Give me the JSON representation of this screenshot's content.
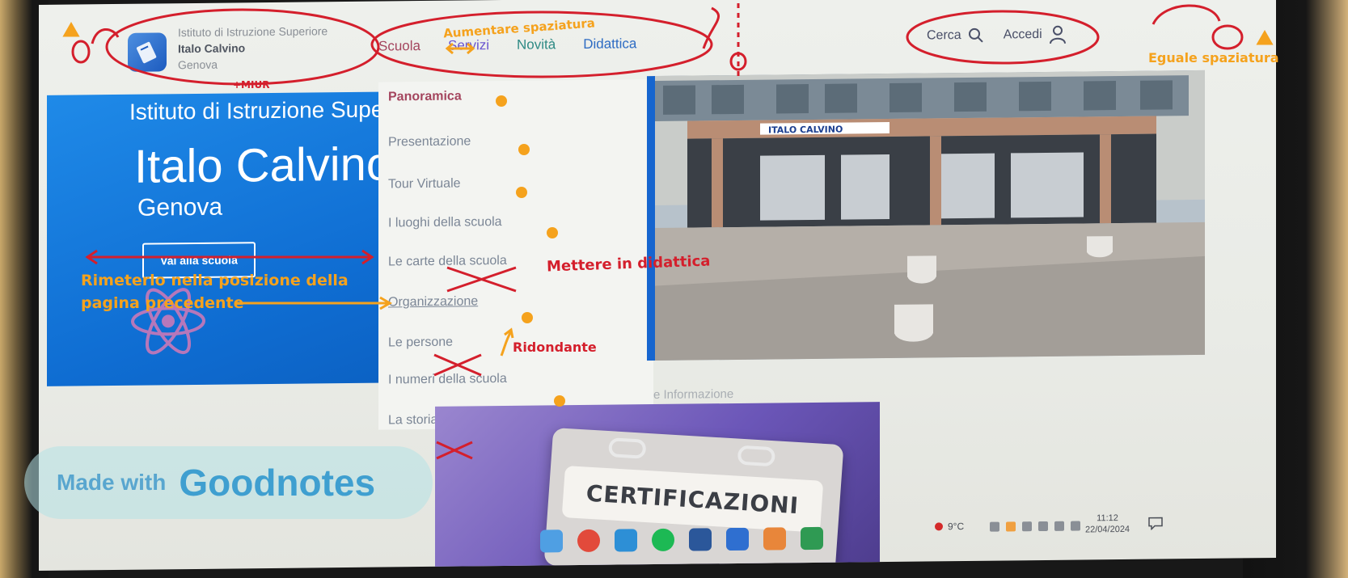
{
  "header": {
    "brand_line1": "Istituto di Istruzione Superiore",
    "brand_line2": "Italo Calvino",
    "brand_line3": "Genova",
    "nav": [
      "Scuola",
      "Servizi",
      "Novità",
      "Didattica"
    ],
    "search_label": "Cerca",
    "login_label": "Accedi"
  },
  "hero": {
    "title_small": "Istituto di Istruzione Supe",
    "title": "Italo Calvino",
    "subtitle": "Genova",
    "button_label": "Vai alla scuola"
  },
  "dropdown": {
    "items": [
      "Panoramica",
      "Presentazione",
      "Tour Virtuale",
      "I luoghi della scuola",
      "Le carte della scuola",
      "Organizzazione",
      "Le persone",
      "I numeri della scuola",
      "La storia"
    ]
  },
  "photo": {
    "sign_text": "ITALO CALVINO"
  },
  "lower": {
    "info_label": "e Informazione",
    "card_text": "CERTIFICAZIONI"
  },
  "taskbar": {
    "temperature": "9°C",
    "time": "11:12",
    "date": "22/04/2024"
  },
  "watermark": {
    "small": "Made with",
    "big": "Goodnotes"
  },
  "annotations": {
    "spacing_increase": "Aumentare spaziatura",
    "miur": "+MIUR",
    "equal_spacing": "Eguale spaziatura",
    "restore_line1": "Rimeterlo nella posizione della",
    "restore_line2": "pagina precedente",
    "move_to_didattica": "Mettere in didattica",
    "redundant": "Ridondante"
  },
  "colors": {
    "accent_red": "#d41f2c",
    "accent_orange": "#f5a21d",
    "hero_blue": "#1478de",
    "nav_scuola": "#a4455e",
    "nav_servizi": "#6a55d0",
    "nav_novita": "#2e8a84",
    "nav_didattica": "#2e6cc3"
  }
}
